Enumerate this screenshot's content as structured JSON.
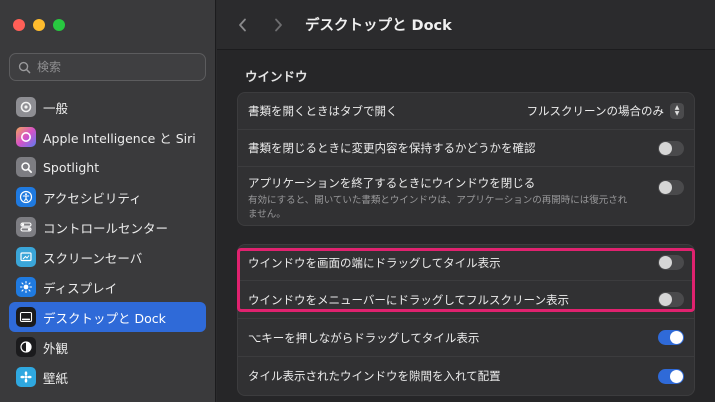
{
  "sidebar": {
    "search_placeholder": "検索",
    "items": [
      {
        "label": "一般",
        "icon": "gear-icon",
        "color": "#8e8e93"
      },
      {
        "label": "Apple Intelligence と Siri",
        "icon": "siri-icon",
        "color": "#c85cd6"
      },
      {
        "label": "Spotlight",
        "icon": "spotlight-search-icon",
        "color": "#7d7d82"
      },
      {
        "label": "アクセシビリティ",
        "icon": "accessibility-icon",
        "color": "#1f7ae0"
      },
      {
        "label": "コントロールセンター",
        "icon": "control-center-icon",
        "color": "#7d7d82"
      },
      {
        "label": "スクリーンセーバ",
        "icon": "screensaver-icon",
        "color": "#3aa5d8"
      },
      {
        "label": "ディスプレイ",
        "icon": "display-brightness-icon",
        "color": "#1f7ae0"
      },
      {
        "label": "デスクトップと Dock",
        "icon": "dock-icon",
        "color": "#1b1b1d",
        "active": true
      },
      {
        "label": "外観",
        "icon": "appearance-icon",
        "color": "#1b1b1d"
      },
      {
        "label": "壁紙",
        "icon": "wallpaper-icon",
        "color": "#2fa8e0"
      }
    ]
  },
  "toolbar": {
    "back": "〈",
    "forward": "〉",
    "title": "デスクトップと Dock"
  },
  "section": {
    "title": "ウインドウ"
  },
  "group1": {
    "rows": [
      {
        "label": "書類を開くときはタブで開く",
        "select_value": "フルスクリーンの場合のみ"
      },
      {
        "label": "書類を閉じるときに変更内容を保持するかどうかを確認",
        "toggle": false
      },
      {
        "label": "アプリケーションを終了するときにウインドウを閉じる",
        "sub": "有効にすると、開いていた書類とウインドウは、アプリケーションの再開時には復元されません。",
        "toggle": false
      }
    ]
  },
  "group2": {
    "rows": [
      {
        "label": "ウインドウを画面の端にドラッグしてタイル表示",
        "toggle": false
      },
      {
        "label": "ウインドウをメニューバーにドラッグしてフルスクリーン表示",
        "toggle": false
      },
      {
        "label": "⌥キーを押しながらドラッグしてタイル表示",
        "toggle": true
      },
      {
        "label": "タイル表示されたウインドウを隙間を入れて配置",
        "toggle": true
      }
    ]
  },
  "colors": {
    "accent": "#2f6ad8",
    "highlight": "#e0226f"
  }
}
